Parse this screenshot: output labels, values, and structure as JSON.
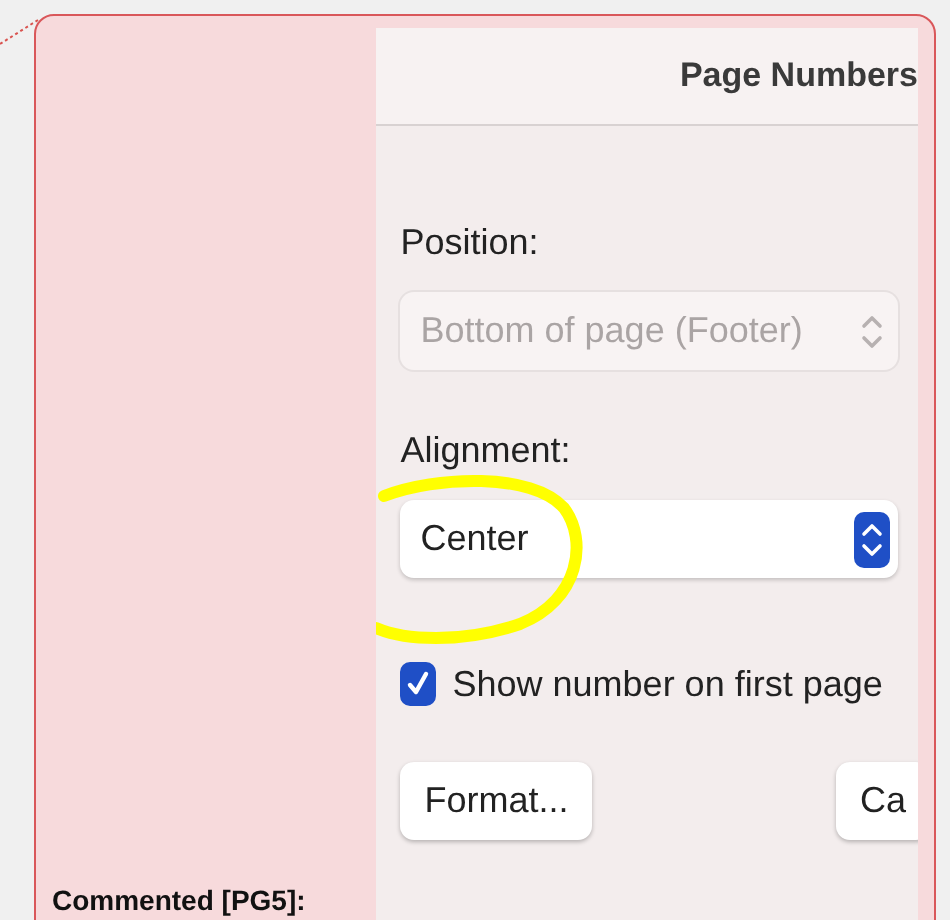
{
  "comment": {
    "label": "Commented [PG5]:"
  },
  "dialog": {
    "title": "Page Numbers",
    "fields": [
      {
        "label": "Position:",
        "value": "Bottom of page (Footer)",
        "disabled": true
      },
      {
        "label": "Alignment:",
        "value": "Center",
        "disabled": false
      }
    ],
    "checkbox": {
      "label": "Show number on first page",
      "checked": true
    },
    "buttons": [
      "Format...",
      "Ca"
    ]
  }
}
